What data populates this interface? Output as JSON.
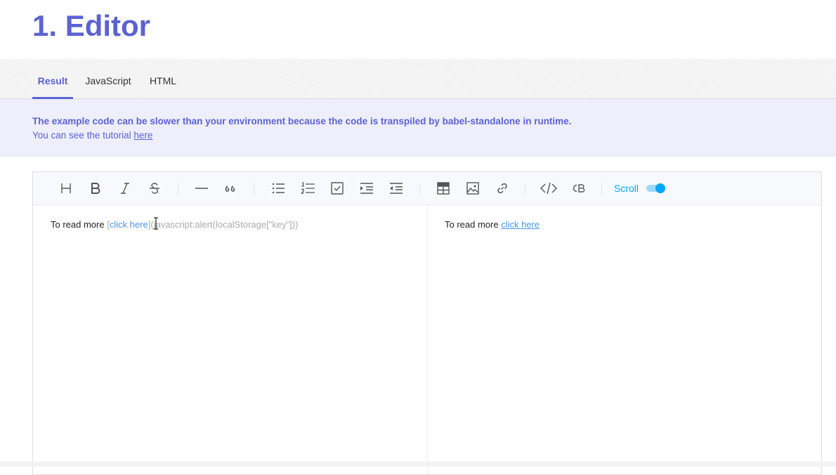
{
  "page": {
    "title": "1. Editor"
  },
  "tabs": [
    {
      "label": "Result",
      "active": true
    },
    {
      "label": "JavaScript",
      "active": false
    },
    {
      "label": "HTML",
      "active": false
    }
  ],
  "notice": {
    "line1": "The example code can be slower than your environment because the code is transpiled by babel-standalone in runtime.",
    "line2_prefix": "You can see the tutorial ",
    "line2_link": "here"
  },
  "toolbar": {
    "buttons": [
      {
        "name": "heading",
        "icon": "heading-icon",
        "glyph": "H"
      },
      {
        "name": "bold",
        "icon": "bold-icon",
        "glyph": "B"
      },
      {
        "name": "italic",
        "icon": "italic-icon",
        "glyph": "I"
      },
      {
        "name": "strike",
        "icon": "strike-icon",
        "glyph": "S"
      },
      {
        "name": "horizontal-rule",
        "icon": "hr-icon"
      },
      {
        "name": "quote",
        "icon": "quote-icon"
      },
      {
        "name": "bullet-list",
        "icon": "bullet-list-icon"
      },
      {
        "name": "ordered-list",
        "icon": "ordered-list-icon"
      },
      {
        "name": "task-list",
        "icon": "task-list-icon"
      },
      {
        "name": "indent",
        "icon": "indent-icon"
      },
      {
        "name": "outdent",
        "icon": "outdent-icon"
      },
      {
        "name": "table",
        "icon": "table-icon"
      },
      {
        "name": "image",
        "icon": "image-icon"
      },
      {
        "name": "link",
        "icon": "link-icon"
      },
      {
        "name": "code",
        "icon": "code-icon"
      },
      {
        "name": "code-block",
        "icon": "code-block-icon",
        "glyph": "CB"
      }
    ],
    "scroll_label": "Scroll",
    "scroll_sync_on": true,
    "accent_color": "#00a9ff"
  },
  "markdown_pane": {
    "prefix": "To read more ",
    "link_open": "[",
    "link_text": "click here",
    "link_close": "]",
    "url_part": "(javascript:alert(localStorage[\"key\"]))"
  },
  "preview_pane": {
    "prefix": "To read more ",
    "link_text": "click here"
  },
  "colors": {
    "brand": "#5b63d3",
    "notice_bg": "#eeeefc",
    "link": "#4b96e6"
  }
}
